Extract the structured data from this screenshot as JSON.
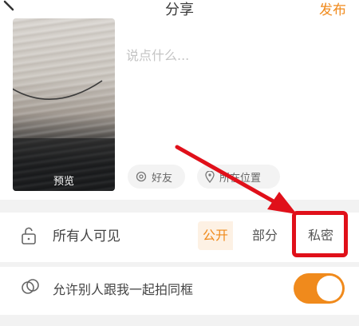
{
  "header": {
    "title": "分享",
    "publish_label": "发布"
  },
  "compose": {
    "placeholder": "说点什么...",
    "preview_label": "预览",
    "chips": {
      "friends": "好友",
      "location": "所在位置"
    }
  },
  "visibility": {
    "label": "所有人可见",
    "options": [
      "公开",
      "部分",
      "私密"
    ],
    "selected": "公开"
  },
  "collab": {
    "label": "允许别人跟我一起拍同框",
    "enabled": true
  },
  "colors": {
    "accent": "#f08a1c",
    "annotation": "#e0101a"
  }
}
